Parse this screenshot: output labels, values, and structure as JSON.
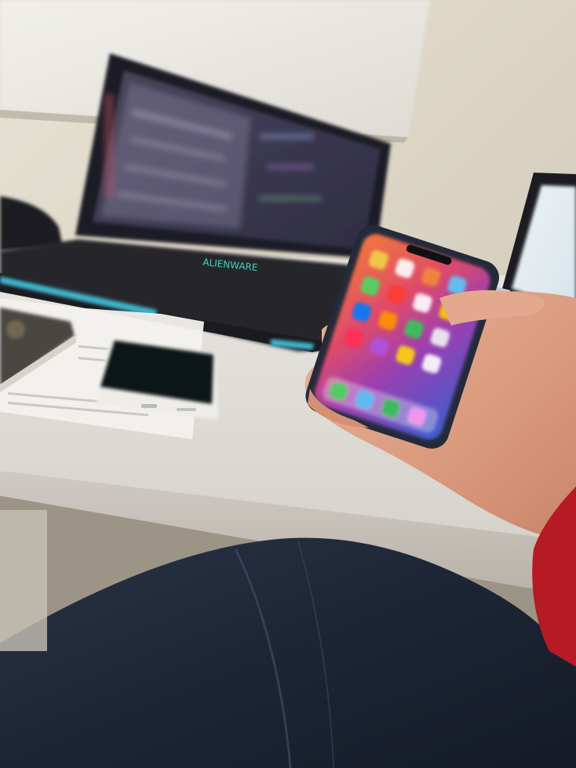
{
  "scene": {
    "laptop": {
      "brand_text": "ALIENWARE"
    }
  }
}
